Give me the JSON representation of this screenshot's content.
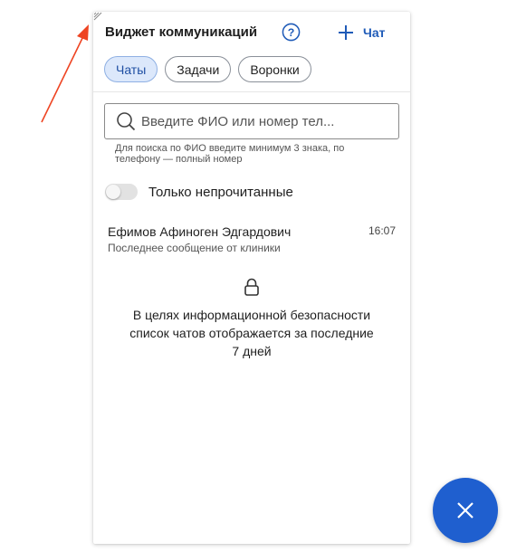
{
  "widget": {
    "title": "Виджет коммуникаций",
    "new_chat_label": "Чат",
    "accent_color": "#1f5bb8"
  },
  "tabs": [
    {
      "label": "Чаты",
      "active": true
    },
    {
      "label": "Задачи",
      "active": false
    },
    {
      "label": "Воронки",
      "active": false
    }
  ],
  "search": {
    "placeholder": "Введите ФИО или номер тел...",
    "hint_line1": "Для поиска по ФИО введите минимум 3 знака, по",
    "hint_line2": "телефону — полный номер"
  },
  "filter": {
    "unread_only_label": "Только непрочитанные",
    "unread_only_enabled": false
  },
  "chats": [
    {
      "name": "Ефимов Афиноген Эдгардович",
      "time": "16:07",
      "preview": "Последнее сообщение от клиники"
    }
  ],
  "security_notice": {
    "line1": "В целях информационной безопасности",
    "line2": "список чатов отображается за последние",
    "line3": "7 дней"
  },
  "fab": {
    "icon": "close-icon",
    "color": "#1f5fcf"
  },
  "annotation": {
    "icon": "arrow-icon",
    "color": "#ee4422"
  }
}
